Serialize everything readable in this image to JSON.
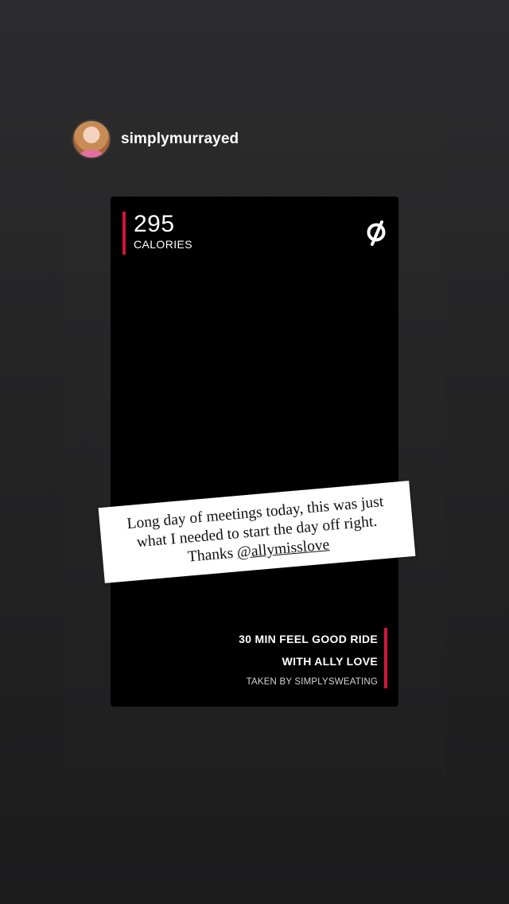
{
  "story": {
    "username": "simplymurrayed",
    "avatar_icon": "avatar-icon"
  },
  "workout": {
    "calories_value": "295",
    "calories_label": "CALORIES",
    "ride_title_line1": "30 MIN FEEL GOOD RIDE",
    "ride_title_line2": "WITH ALLY LOVE",
    "taken_by": "TAKEN BY SIMPLYSWEATING",
    "accent_color": "#d0163a",
    "logo_icon": "peloton-logo-icon"
  },
  "caption": {
    "line1": "Long day of meetings today, this was just",
    "line2": "what I needed to start the day off right.",
    "line3_prefix": "Thanks ",
    "mention": "@allymisslove"
  }
}
